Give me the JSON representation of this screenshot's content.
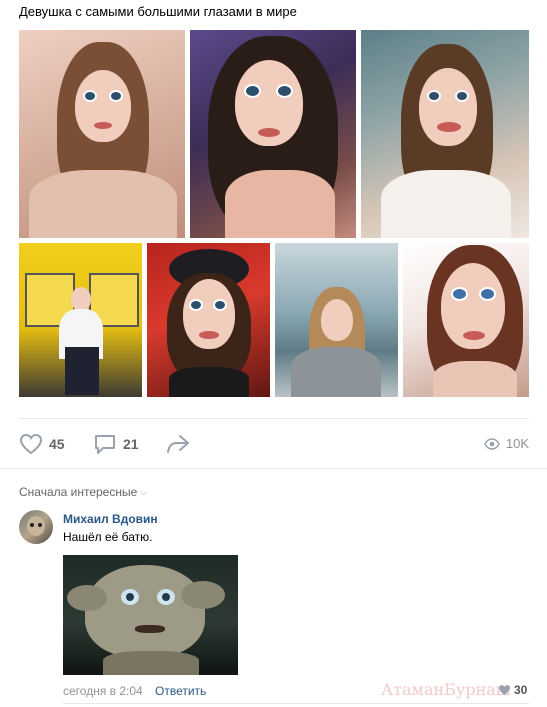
{
  "post": {
    "text": "Девушка с самыми большими глазами в мире"
  },
  "actions": {
    "likes": "45",
    "comments": "21",
    "views": "10K"
  },
  "comments_section": {
    "sort_label": "Сначала интересные",
    "items": [
      {
        "author": "Михаил Вдовин",
        "text": "Нашёл её батю.",
        "time": "сегодня в 2:04",
        "reply_label": "Ответить",
        "likes": "30"
      }
    ]
  },
  "watermark": "АтаманБурнаш",
  "colors": {
    "link": "#2a5885",
    "muted": "#939393",
    "divider": "#e7e8ec"
  }
}
